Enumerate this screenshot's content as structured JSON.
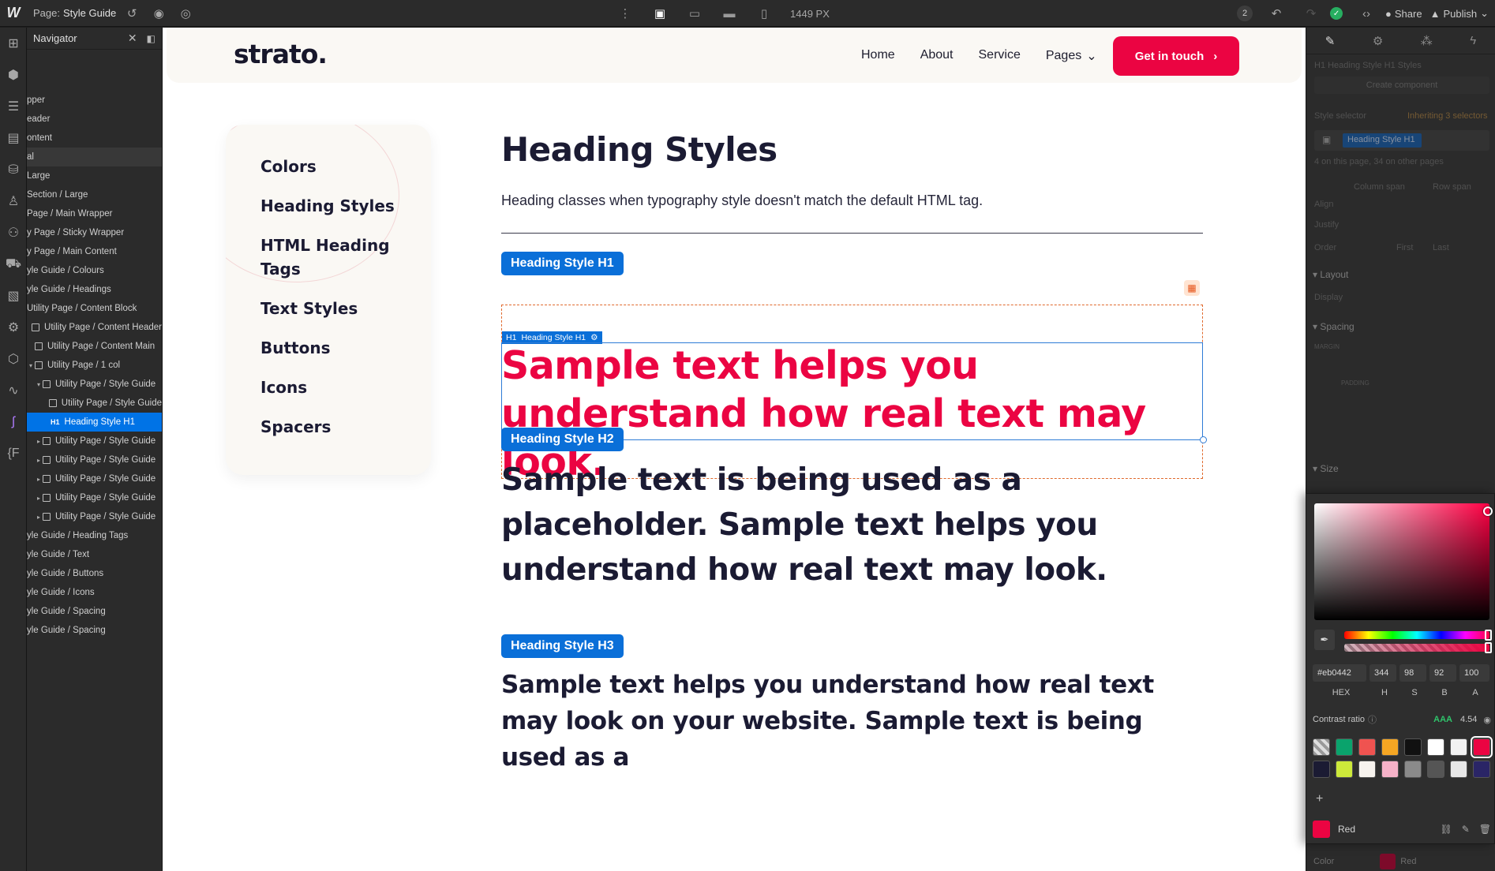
{
  "topbar": {
    "logo": "W",
    "page_label": "Page:",
    "page_name": "Style Guide",
    "px": "1449 PX",
    "badge": "2",
    "share": "Share",
    "publish": "Publish"
  },
  "navigator": {
    "title": "Navigator",
    "rows": [
      {
        "label": "pper",
        "indent": 0,
        "box": false,
        "caret": false
      },
      {
        "label": "eader",
        "indent": 0,
        "box": false,
        "caret": false
      },
      {
        "label": "ontent",
        "indent": 0,
        "box": false,
        "caret": false
      },
      {
        "label": "al",
        "indent": 0,
        "box": false,
        "caret": false,
        "hover": true
      },
      {
        "label": "Large",
        "indent": 0,
        "box": false,
        "caret": false
      },
      {
        "label": "Section / Large",
        "indent": 0,
        "box": false,
        "caret": false
      },
      {
        "label": "Page / Main Wrapper",
        "indent": 0,
        "box": false,
        "caret": false
      },
      {
        "label": "y Page / Sticky Wrapper",
        "indent": 0,
        "box": false,
        "caret": false
      },
      {
        "label": "y Page / Main Content",
        "indent": 0,
        "box": false,
        "caret": false
      },
      {
        "label": "yle Guide / Colours",
        "indent": 0,
        "box": false,
        "caret": false
      },
      {
        "label": "yle Guide / Headings",
        "indent": 0,
        "box": false,
        "caret": false
      },
      {
        "label": "Utility Page / Content Block",
        "indent": 0,
        "box": false,
        "caret": false
      },
      {
        "label": "Utility Page / Content Header",
        "indent": 0,
        "box": true,
        "caret": false
      },
      {
        "label": "Utility Page / Content Main",
        "indent": 0,
        "box": true,
        "caret": false
      },
      {
        "label": "Utility Page / 1 col",
        "indent": 1,
        "box": true,
        "caret": true
      },
      {
        "label": "Utility Page / Style Guide",
        "indent": 2,
        "box": true,
        "caret": true
      },
      {
        "label": "Utility Page / Style Guide",
        "indent": 3,
        "box": true,
        "caret": false
      },
      {
        "label": "Heading Style H1",
        "indent": 3,
        "box": false,
        "caret": false,
        "h1": true,
        "selected": true
      },
      {
        "label": "Utility Page / Style Guide",
        "indent": 2,
        "box": true,
        "caret": true
      },
      {
        "label": "Utility Page / Style Guide",
        "indent": 2,
        "box": true,
        "caret": true
      },
      {
        "label": "Utility Page / Style Guide",
        "indent": 2,
        "box": true,
        "caret": true
      },
      {
        "label": "Utility Page / Style Guide",
        "indent": 2,
        "box": true,
        "caret": true
      },
      {
        "label": "Utility Page / Style Guide",
        "indent": 2,
        "box": true,
        "caret": true
      },
      {
        "label": "yle Guide / Heading Tags",
        "indent": 0,
        "box": false,
        "caret": false
      },
      {
        "label": "yle Guide / Text",
        "indent": 0,
        "box": false,
        "caret": false
      },
      {
        "label": "yle Guide / Buttons",
        "indent": 0,
        "box": false,
        "caret": false
      },
      {
        "label": "yle Guide / Icons",
        "indent": 0,
        "box": false,
        "caret": false
      },
      {
        "label": "yle Guide / Spacing",
        "indent": 0,
        "box": false,
        "caret": false
      },
      {
        "label": "yle Guide / Spacing",
        "indent": 0,
        "box": false,
        "caret": false
      }
    ]
  },
  "site": {
    "logo": "strato.",
    "menu": [
      "Home",
      "About",
      "Service"
    ],
    "pages": "Pages",
    "cta": "Get in touch",
    "sidebar": [
      "Colors",
      "Heading Styles",
      "HTML Heading Tags",
      "Text Styles",
      "Buttons",
      "Icons",
      "Spacers"
    ],
    "title": "Heading Styles",
    "description": "Heading classes when typography style doesn't match the default HTML tag.",
    "h1_tag": "Heading Style H1",
    "h1_chip": "Heading Style H1",
    "h1_chip_prefix": "H1",
    "h1_text": "Sample text helps you understand how real text may look.",
    "h2_tag": "Heading Style H2",
    "h2_text": "Sample text is being used as a placeholder. Sample text helps you understand how real text may look.",
    "h3_tag": "Heading Style H3",
    "h3_text": "Sample text helps you understand how real text may look on your website. Sample text is being used as a"
  },
  "style_panel": {
    "breadcrumb": "H1 Heading Style H1 Styles",
    "create_component": "Create component",
    "style_selector": "Style selector",
    "inheriting": "Inheriting 3 selectors",
    "selector_chip": "Heading Style H1",
    "on_page": "4 on this page, 34 on other pages",
    "column_span": "Column span",
    "row_span": "Row span",
    "align": "Align",
    "justify": "Justify",
    "order": "Order",
    "first": "First",
    "last": "Last",
    "layout": "Layout",
    "display": "Display",
    "spacing": "Spacing",
    "margin": "MARGIN",
    "padding": "PADDING",
    "size": "Size",
    "color_label": "Color",
    "color_name_bottom": "Red"
  },
  "picker": {
    "hex": "#eb0442",
    "h": "344",
    "s": "98",
    "b": "92",
    "a": "100",
    "labels": [
      "HEX",
      "H",
      "S",
      "B",
      "A"
    ],
    "contrast_label": "Contrast ratio",
    "contrast_grade": "AAA",
    "contrast_value": "4.54",
    "swatches": [
      "#cccccc",
      "#0aa36c",
      "#ef5350",
      "#f5a623",
      "#111111",
      "#ffffff",
      "#f2f2f2",
      "#eb0442",
      "#1b1b33",
      "#cde93a",
      "#f7f3ee",
      "#f6b2c8",
      "#8a8a8a",
      "#555555",
      "#e8e8e8",
      "#2a2566"
    ],
    "current_name": "Red",
    "current_color": "#eb0442"
  },
  "colors": {
    "brand_red": "#eb0442",
    "select_blue": "#0a6fd8",
    "dark_text": "#1b1b33"
  }
}
